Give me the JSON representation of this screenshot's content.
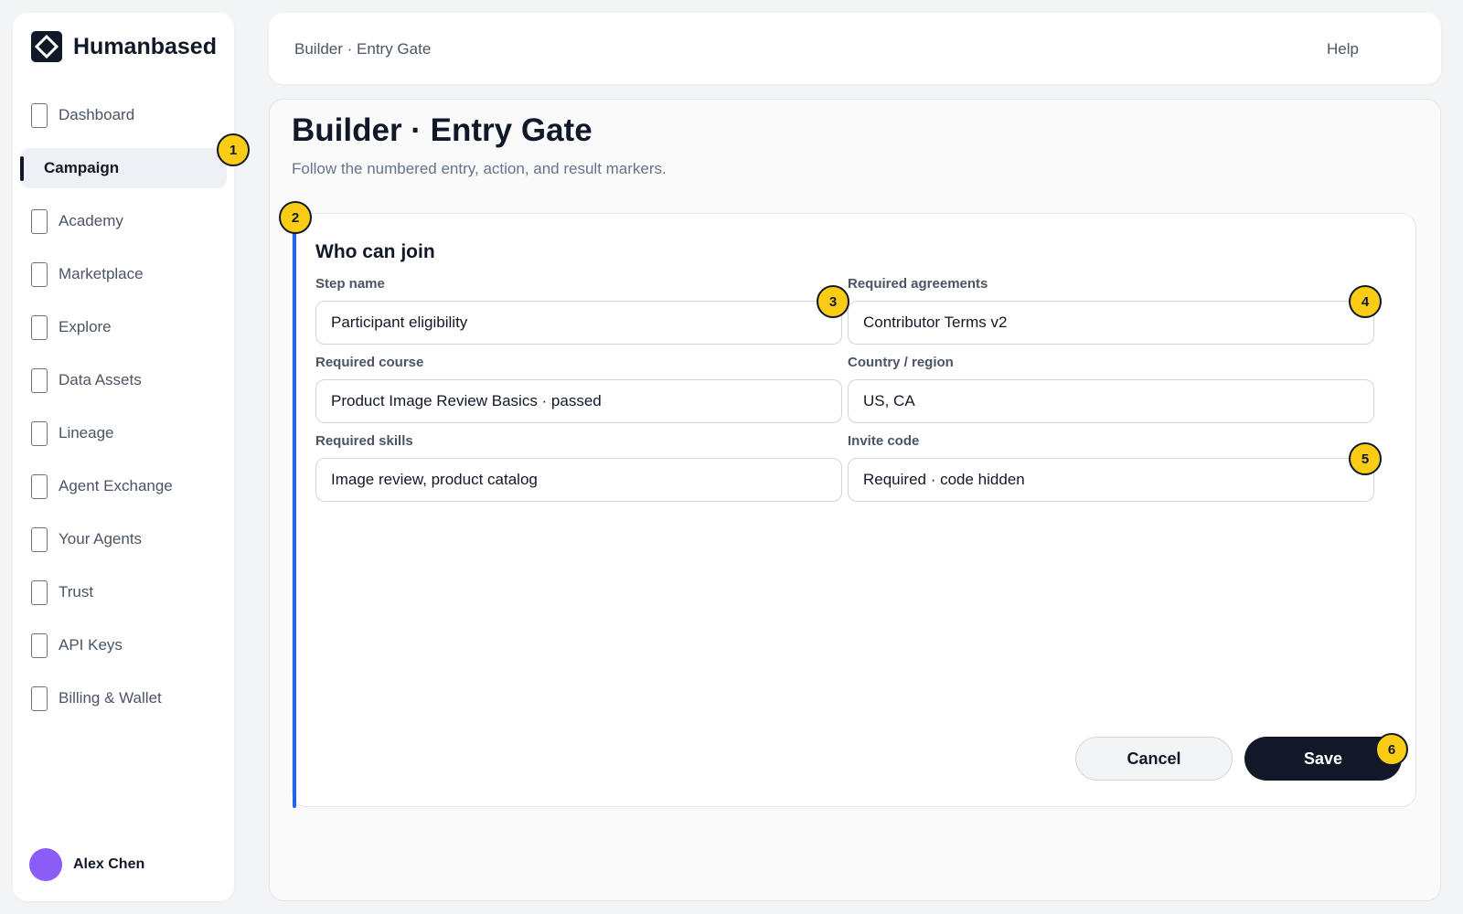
{
  "brand": {
    "name": "Humanbased",
    "logo_icon": "diamond-logo-icon"
  },
  "sidebar": {
    "items": [
      {
        "label": "Dashboard",
        "icon": "page-icon",
        "active": false
      },
      {
        "label": "Campaign",
        "icon": "page-icon",
        "active": true
      },
      {
        "label": "Academy",
        "icon": "page-icon",
        "active": false
      },
      {
        "label": "Marketplace",
        "icon": "page-icon",
        "active": false
      },
      {
        "label": "Explore",
        "icon": "page-icon",
        "active": false
      },
      {
        "label": "Data Assets",
        "icon": "page-icon",
        "active": false
      },
      {
        "label": "Lineage",
        "icon": "page-icon",
        "active": false
      },
      {
        "label": "Agent Exchange",
        "icon": "page-icon",
        "active": false
      },
      {
        "label": "Your Agents",
        "icon": "page-icon",
        "active": false
      },
      {
        "label": "Trust",
        "icon": "page-icon",
        "active": false
      },
      {
        "label": "API Keys",
        "icon": "page-icon",
        "active": false
      },
      {
        "label": "Billing & Wallet",
        "icon": "page-icon",
        "active": false
      }
    ],
    "user": {
      "name": "Alex Chen",
      "avatar_color": "#8b5cf6"
    }
  },
  "topbar": {
    "breadcrumb": "Builder · Entry Gate",
    "help_label": "Help"
  },
  "main": {
    "title": "Builder · Entry Gate",
    "subtitle": "Follow the numbered entry, action, and result markers.",
    "card": {
      "title": "Who can join",
      "fields": [
        {
          "label": "Step name",
          "value": "Participant eligibility"
        },
        {
          "label": "Required agreements",
          "value": "Contributor Terms v2"
        },
        {
          "label": "Required course",
          "value": "Product Image Review Basics · passed"
        },
        {
          "label": "Country / region",
          "value": "US, CA"
        },
        {
          "label": "Required skills",
          "value": "Image review, product catalog"
        },
        {
          "label": "Invite code",
          "value": "Required · code hidden"
        }
      ],
      "cancel_label": "Cancel",
      "save_label": "Save"
    }
  },
  "markers": [
    "1",
    "2",
    "3",
    "4",
    "5",
    "6"
  ],
  "colors": {
    "accent": "#2563eb",
    "marker": "#facc15",
    "primary_button": "#111827",
    "avatar": "#8b5cf6"
  }
}
